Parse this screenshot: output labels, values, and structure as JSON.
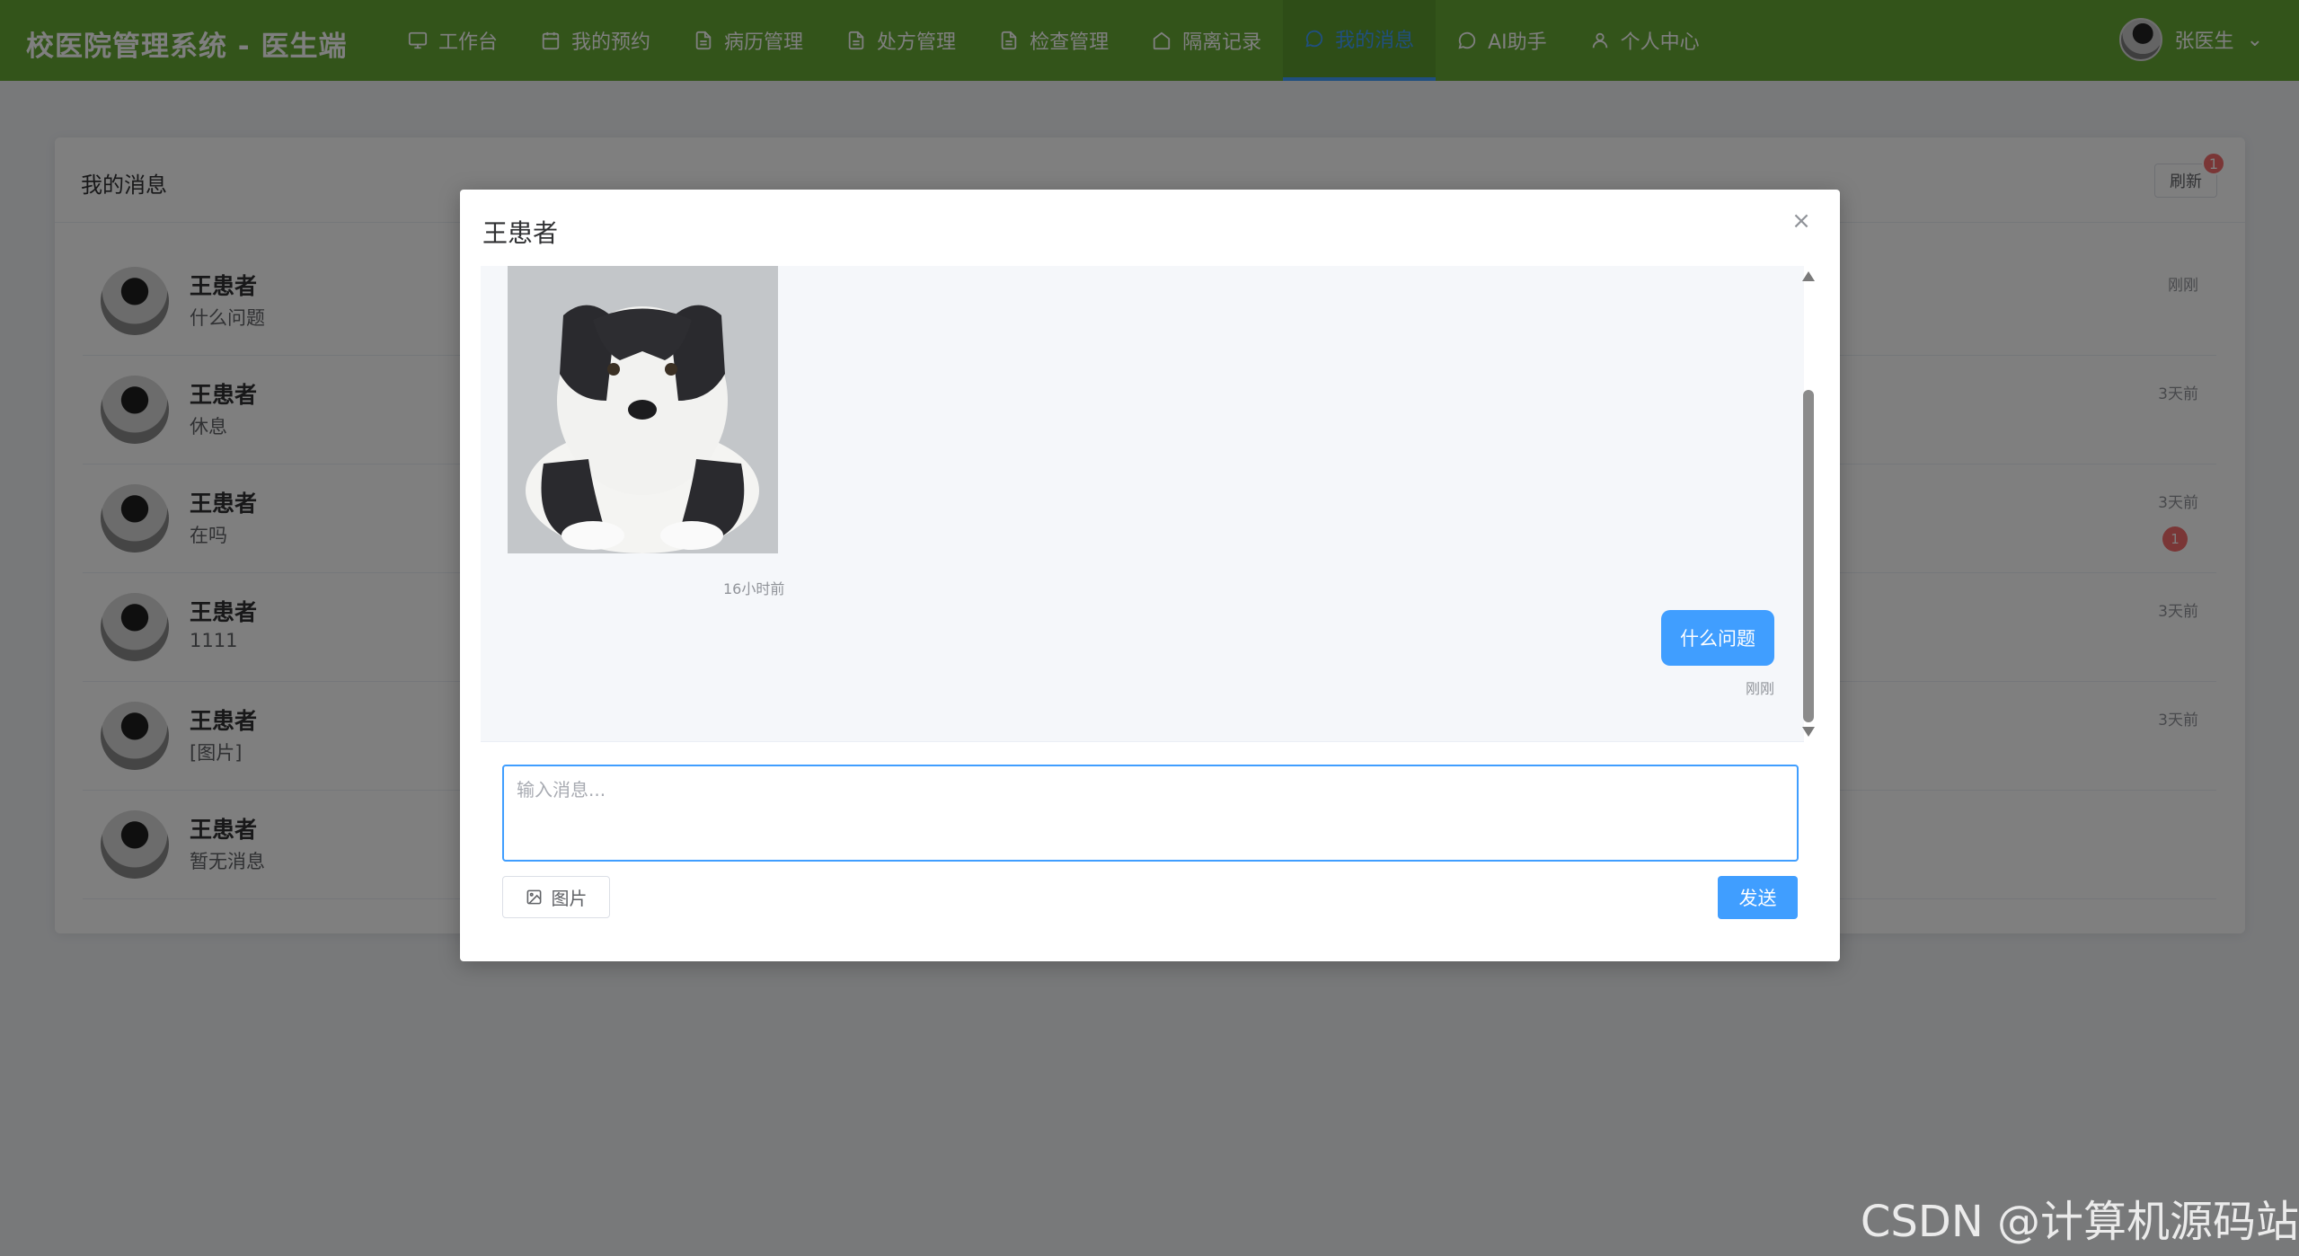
{
  "app": {
    "title": "校医院管理系统 - 医生端"
  },
  "nav": {
    "items": [
      {
        "label": "工作台",
        "icon": "monitor-icon"
      },
      {
        "label": "我的预约",
        "icon": "calendar-icon"
      },
      {
        "label": "病历管理",
        "icon": "document-icon"
      },
      {
        "label": "处方管理",
        "icon": "document-icon"
      },
      {
        "label": "检查管理",
        "icon": "document-icon"
      },
      {
        "label": "隔离记录",
        "icon": "house-icon"
      },
      {
        "label": "我的消息",
        "icon": "chat-icon",
        "active": true
      },
      {
        "label": "AI助手",
        "icon": "chat-icon"
      },
      {
        "label": "个人中心",
        "icon": "user-icon"
      }
    ],
    "user": {
      "name": "张医生"
    }
  },
  "messages_card": {
    "title": "我的消息",
    "refresh_label": "刷新",
    "refresh_badge": "1",
    "conversations": [
      {
        "name": "王患者",
        "last": "什么问题",
        "time": "刚刚",
        "unread": ""
      },
      {
        "name": "王患者",
        "last": "休息",
        "time": "3天前",
        "unread": ""
      },
      {
        "name": "王患者",
        "last": "在吗",
        "time": "3天前",
        "unread": "1"
      },
      {
        "name": "王患者",
        "last": "1111",
        "time": "3天前",
        "unread": ""
      },
      {
        "name": "王患者",
        "last": "[图片]",
        "time": "3天前",
        "unread": ""
      },
      {
        "name": "王患者",
        "last": "暂无消息",
        "time": "",
        "unread": ""
      }
    ]
  },
  "dialog": {
    "title": "王患者",
    "messages": [
      {
        "type": "image",
        "side": "left",
        "time": "16小时前"
      },
      {
        "type": "text",
        "side": "right",
        "text": "什么问题",
        "time": "刚刚"
      }
    ],
    "input_placeholder": "输入消息...",
    "image_button_label": "图片",
    "send_button_label": "发送"
  },
  "watermark": "CSDN @计算机源码站",
  "colors": {
    "nav": "#67a935",
    "accent": "#409eff",
    "badge": "#f56c6c"
  }
}
